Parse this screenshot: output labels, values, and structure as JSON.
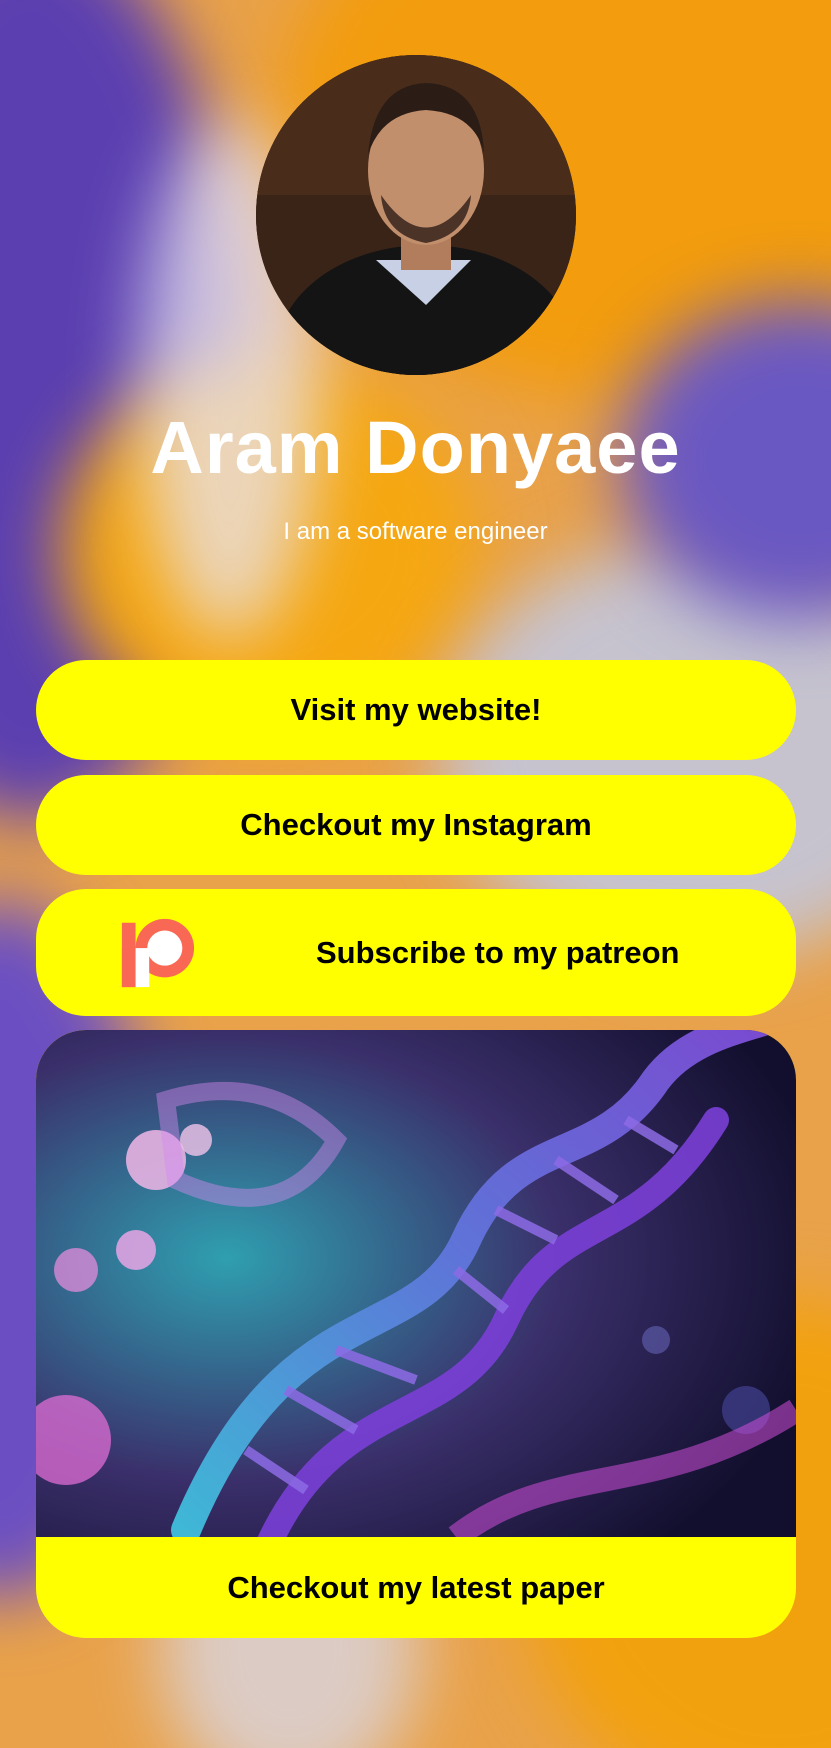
{
  "profile": {
    "name": "Aram Donyaee",
    "tagline": "I am a software engineer",
    "avatar_icon": "profile-photo"
  },
  "links": {
    "website": "Visit my website!",
    "instagram": "Checkout my Instagram",
    "patreon": "Subscribe to my patreon",
    "paper": "Checkout my latest paper"
  },
  "colors": {
    "button": "#ffff00",
    "patreon": "#f96854"
  }
}
